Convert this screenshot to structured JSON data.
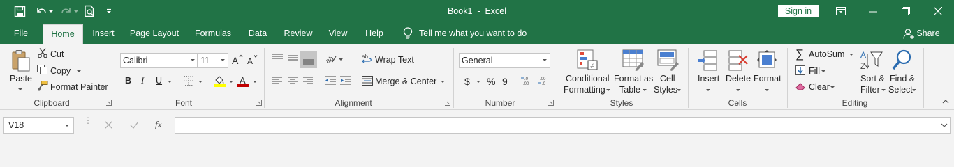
{
  "window": {
    "title": "Book1  -  Excel",
    "sign_in": "Sign in"
  },
  "tabs": [
    "File",
    "Home",
    "Insert",
    "Page Layout",
    "Formulas",
    "Data",
    "Review",
    "View",
    "Help"
  ],
  "tell_me": "Tell me what you want to do",
  "share": "Share",
  "clipboard": {
    "paste": "Paste",
    "cut": "Cut",
    "copy": "Copy",
    "format_painter": "Format Painter",
    "group_label": "Clipboard"
  },
  "font": {
    "name": "Calibri",
    "size": "11",
    "bold": "B",
    "italic": "I",
    "underline": "U",
    "group_label": "Font"
  },
  "alignment": {
    "wrap_text": "Wrap Text",
    "merge_center": "Merge & Center",
    "group_label": "Alignment"
  },
  "number": {
    "format": "General",
    "currency": "$",
    "percent": "%",
    "comma": "9",
    "group_label": "Number"
  },
  "styles": {
    "conditional_1": "Conditional",
    "conditional_2": "Formatting",
    "format_table_1": "Format as",
    "format_table_2": "Table",
    "cell_styles_1": "Cell",
    "cell_styles_2": "Styles",
    "group_label": "Styles"
  },
  "cells": {
    "insert": "Insert",
    "delete": "Delete",
    "format": "Format",
    "group_label": "Cells"
  },
  "editing": {
    "autosum": "AutoSum",
    "fill": "Fill",
    "clear": "Clear",
    "sort_1": "Sort &",
    "sort_2": "Filter",
    "find_1": "Find &",
    "find_2": "Select",
    "group_label": "Editing"
  },
  "formula_bar": {
    "name_box": "V18",
    "fx": "fx",
    "formula": ""
  },
  "colors": {
    "excel_green": "#217346",
    "highlight_yellow": "#ffff00",
    "font_red": "#c00000"
  }
}
